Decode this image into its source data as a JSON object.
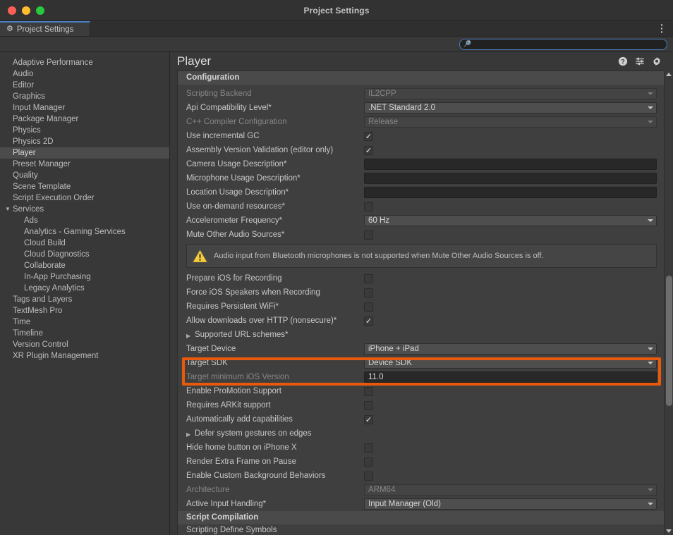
{
  "window": {
    "title": "Project Settings",
    "traffic_lights": [
      "close-red",
      "minimize-yellow",
      "maximize-green"
    ]
  },
  "tab": {
    "label": "Project Settings",
    "icon": "gear-icon",
    "menu_icon": "kebab-menu-icon"
  },
  "search": {
    "value": "",
    "placeholder": "",
    "icon": "search-icon"
  },
  "sidebar": {
    "items": [
      {
        "label": "Adaptive Performance",
        "selected": false,
        "level": 0
      },
      {
        "label": "Audio",
        "selected": false,
        "level": 0
      },
      {
        "label": "Editor",
        "selected": false,
        "level": 0
      },
      {
        "label": "Graphics",
        "selected": false,
        "level": 0
      },
      {
        "label": "Input Manager",
        "selected": false,
        "level": 0
      },
      {
        "label": "Package Manager",
        "selected": false,
        "level": 0
      },
      {
        "label": "Physics",
        "selected": false,
        "level": 0
      },
      {
        "label": "Physics 2D",
        "selected": false,
        "level": 0
      },
      {
        "label": "Player",
        "selected": true,
        "level": 0
      },
      {
        "label": "Preset Manager",
        "selected": false,
        "level": 0
      },
      {
        "label": "Quality",
        "selected": false,
        "level": 0
      },
      {
        "label": "Scene Template",
        "selected": false,
        "level": 0
      },
      {
        "label": "Script Execution Order",
        "selected": false,
        "level": 0
      },
      {
        "label": "Services",
        "selected": false,
        "level": 0,
        "expanded": true,
        "twisty": "▼"
      },
      {
        "label": "Ads",
        "selected": false,
        "level": 1
      },
      {
        "label": "Analytics - Gaming Services",
        "selected": false,
        "level": 1
      },
      {
        "label": "Cloud Build",
        "selected": false,
        "level": 1
      },
      {
        "label": "Cloud Diagnostics",
        "selected": false,
        "level": 1
      },
      {
        "label": "Collaborate",
        "selected": false,
        "level": 1
      },
      {
        "label": "In-App Purchasing",
        "selected": false,
        "level": 1
      },
      {
        "label": "Legacy Analytics",
        "selected": false,
        "level": 1
      },
      {
        "label": "Tags and Layers",
        "selected": false,
        "level": 0
      },
      {
        "label": "TextMesh Pro",
        "selected": false,
        "level": 0
      },
      {
        "label": "Time",
        "selected": false,
        "level": 0
      },
      {
        "label": "Timeline",
        "selected": false,
        "level": 0
      },
      {
        "label": "Version Control",
        "selected": false,
        "level": 0
      },
      {
        "label": "XR Plugin Management",
        "selected": false,
        "level": 0
      }
    ]
  },
  "main": {
    "title": "Player",
    "header_icons": [
      "help-icon",
      "preset-icon",
      "gear-icon"
    ],
    "sections": [
      {
        "title": "Configuration"
      }
    ],
    "configuration_title": "Configuration",
    "script_compilation_title": "Script Compilation",
    "scripting_define_symbols_label": "Scripting Define Symbols",
    "rows": [
      {
        "label": "Scripting Backend",
        "type": "dropdown",
        "value": "IL2CPP",
        "disabled": true
      },
      {
        "label": "Api Compatibility Level*",
        "type": "dropdown",
        "value": ".NET Standard 2.0",
        "disabled": false
      },
      {
        "label": "C++ Compiler Configuration",
        "type": "dropdown",
        "value": "Release",
        "disabled": true
      },
      {
        "label": "Use incremental GC",
        "type": "checkbox",
        "checked": true
      },
      {
        "label": "Assembly Version Validation (editor only)",
        "type": "checkbox",
        "checked": true
      },
      {
        "label": "Camera Usage Description*",
        "type": "text",
        "value": ""
      },
      {
        "label": "Microphone Usage Description*",
        "type": "text",
        "value": ""
      },
      {
        "label": "Location Usage Description*",
        "type": "text",
        "value": ""
      },
      {
        "label": "Use on-demand resources*",
        "type": "checkbox",
        "checked": false
      },
      {
        "label": "Accelerometer Frequency*",
        "type": "dropdown",
        "value": "60 Hz",
        "disabled": false
      },
      {
        "label": "Mute Other Audio Sources*",
        "type": "checkbox",
        "checked": false
      }
    ],
    "helpbox": {
      "icon": "warning-icon",
      "message": "Audio input from Bluetooth microphones is not supported when Mute Other Audio Sources is off."
    },
    "rows2": [
      {
        "label": "Prepare iOS for Recording",
        "type": "checkbox",
        "checked": false
      },
      {
        "label": "Force iOS Speakers when Recording",
        "type": "checkbox",
        "checked": false
      },
      {
        "label": "Requires Persistent WiFi*",
        "type": "checkbox",
        "checked": false
      },
      {
        "label": "Allow downloads over HTTP (nonsecure)*",
        "type": "checkbox",
        "checked": true
      },
      {
        "label": "Supported URL schemes*",
        "type": "foldout",
        "twisty": "▶"
      },
      {
        "label": "Target Device",
        "type": "dropdown",
        "value": "iPhone + iPad",
        "disabled": false,
        "highlighted": true
      },
      {
        "label": "Target SDK",
        "type": "dropdown",
        "value": "Device SDK",
        "disabled": false,
        "highlighted": true
      },
      {
        "label": "Target minimum iOS Version",
        "type": "text",
        "value": "11.0",
        "label_dim": true
      },
      {
        "label": "Enable ProMotion Support",
        "type": "checkbox",
        "checked": false
      },
      {
        "label": "Requires ARKit support",
        "type": "checkbox",
        "checked": false
      },
      {
        "label": "Automatically add capabilities",
        "type": "checkbox",
        "checked": true
      },
      {
        "label": "Defer system gestures on edges",
        "type": "foldout",
        "twisty": "▶"
      },
      {
        "label": "Hide home button on iPhone X",
        "type": "checkbox",
        "checked": false
      },
      {
        "label": "Render Extra Frame on Pause",
        "type": "checkbox",
        "checked": false
      },
      {
        "label": "Enable Custom Background Behaviors",
        "type": "checkbox",
        "checked": false
      },
      {
        "label": "Architecture",
        "type": "dropdown",
        "value": "ARM64",
        "disabled": true
      },
      {
        "label": "Active Input Handling*",
        "type": "dropdown",
        "value": "Input Manager (Old)",
        "disabled": false
      }
    ]
  },
  "colors": {
    "highlight": "#e8590c",
    "accent": "#4a7ec0",
    "warning": "#f2cb3f"
  },
  "scrollbar": {
    "up_arrow": "scroll-up-arrow",
    "down_arrow": "scroll-down-arrow",
    "thumb_top_pct": 44,
    "thumb_height_pct": 29
  }
}
